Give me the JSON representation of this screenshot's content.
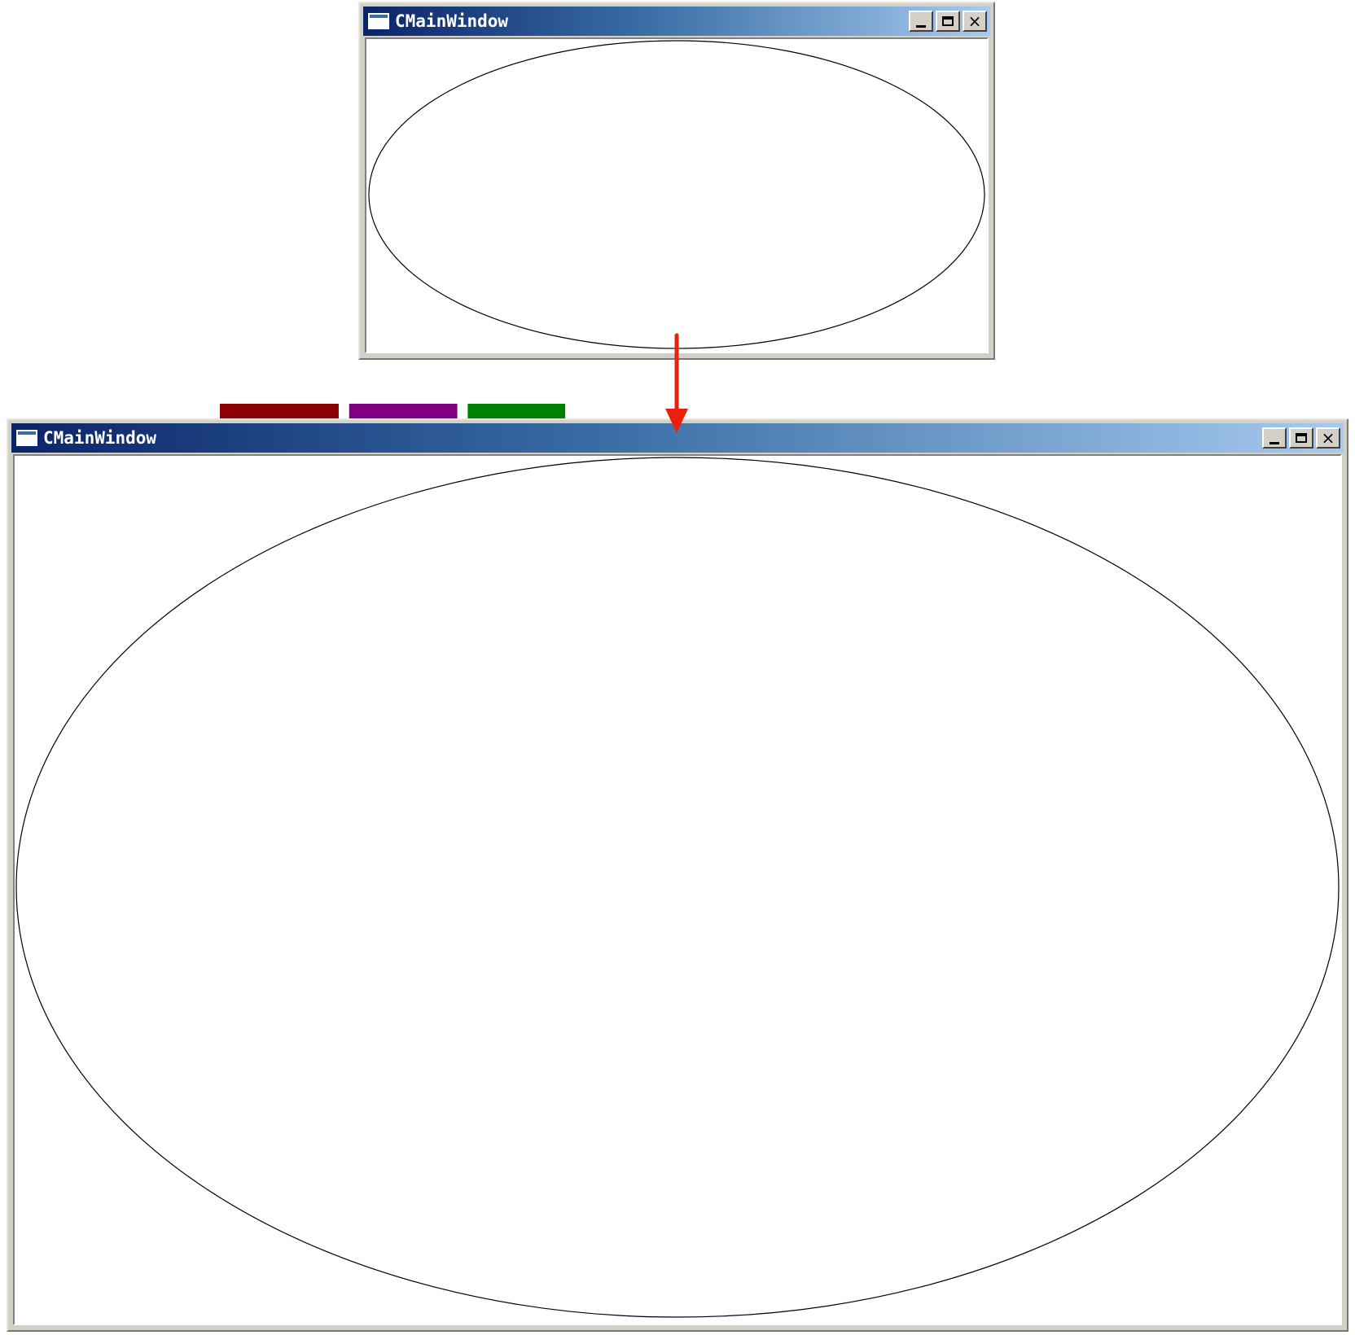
{
  "windows": [
    {
      "id": "before",
      "title": "CMainWindow",
      "controls": {
        "minimize": "_",
        "maximize": "□",
        "close": "×"
      },
      "content": "ellipse"
    },
    {
      "id": "after",
      "title": "CMainWindow",
      "controls": {
        "minimize": "_",
        "maximize": "□",
        "close": "×"
      },
      "content": "ellipse"
    }
  ],
  "colors": {
    "title_gradient_start": "#0a246a",
    "title_gradient_end": "#a6caf0",
    "arrow": "#e8200c",
    "ellipse_stroke": "#000000",
    "client_background": "#ffffff"
  }
}
